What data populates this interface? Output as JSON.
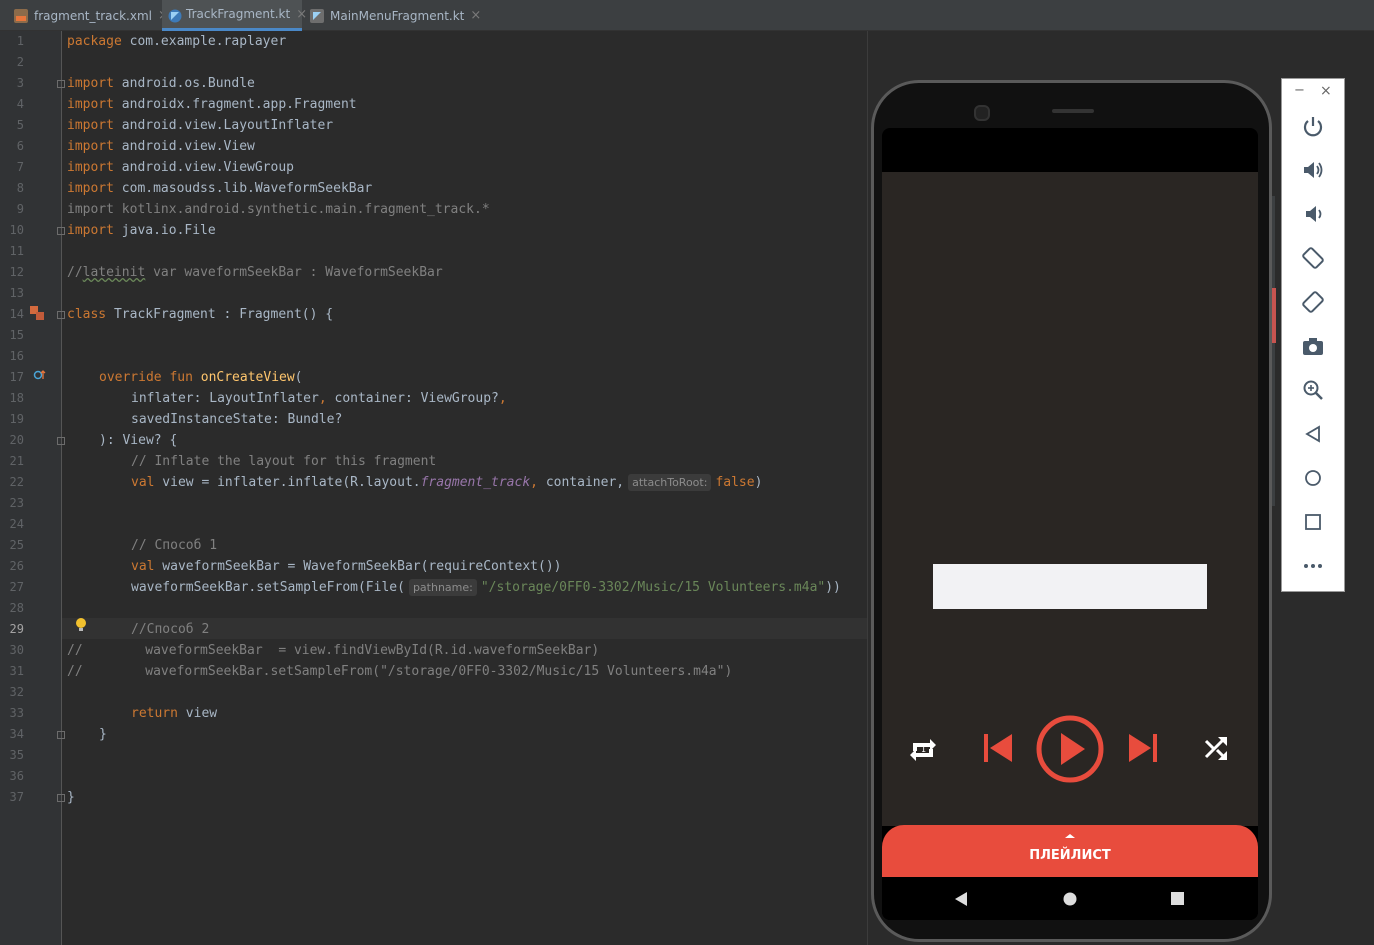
{
  "tabs": [
    {
      "label": "fragment_track.xml",
      "active": false,
      "icon": "xml-file-icon"
    },
    {
      "label": "TrackFragment.kt",
      "active": true,
      "icon": "kotlin-file-icon"
    },
    {
      "label": "MainMenuFragment.kt",
      "active": false,
      "icon": "kotlin-file-icon"
    }
  ],
  "tab_close": "×",
  "line_numbers": [
    "1",
    "2",
    "3",
    "4",
    "5",
    "6",
    "7",
    "8",
    "9",
    "10",
    "11",
    "12",
    "13",
    "14",
    "15",
    "16",
    "17",
    "18",
    "19",
    "20",
    "21",
    "22",
    "23",
    "24",
    "25",
    "26",
    "27",
    "28",
    "29",
    "30",
    "31",
    "32",
    "33",
    "34",
    "35",
    "36",
    "37"
  ],
  "current_line": "29",
  "code": {
    "l1_kw": "package",
    "l1_rest": " com.example.raplayer",
    "l3_kw": "import",
    "l3_rest": " android.os.Bundle",
    "l4_kw": "import",
    "l4_rest": " androidx.fragment.app.Fragment",
    "l5_kw": "import",
    "l5_rest": " android.view.LayoutInflater",
    "l6_kw": "import",
    "l6_rest": " android.view.View",
    "l7_kw": "import",
    "l7_rest": " android.view.ViewGroup",
    "l8_kw": "import",
    "l8_rest": " com.masoudss.lib.WaveformSeekBar",
    "l9": "import kotlinx.android.synthetic.main.fragment_track.*",
    "l10_kw": "import",
    "l10_rest": " java.io.File",
    "l12_a": "//",
    "l12_b": "lateinit",
    "l12_c": " var waveformSeekBar : WaveformSeekBar",
    "l14_kw": "class",
    "l14_rest": " TrackFragment : Fragment() {",
    "l17_kw": "override fun",
    "l17_fn": " onCreateView",
    "l17_rest": "(",
    "l18_a": "inflater: LayoutInflater",
    "l18_b": ",",
    "l18_c": " container: ViewGroup?",
    "l18_d": ",",
    "l19": "savedInstanceState: Bundle?",
    "l20": "): View? {",
    "l21": "// Inflate the layout for this fragment",
    "l22_kw": "val",
    "l22_a": " view = inflater.inflate(R.layout.",
    "l22_it": "fragment_track",
    "l22_b": ",",
    "l22_c": " container,",
    "l22_hint": "attachToRoot:",
    "l22_false": "false",
    "l22_end": ")",
    "l25": "// Способ 1",
    "l26_kw": "val",
    "l26_rest": " waveformSeekBar = WaveformSeekBar(requireContext())",
    "l27_a": "waveformSeekBar.setSampleFrom(File(",
    "l27_hint": "pathname:",
    "l27_str": "\"/storage/0FF0-3302/Music/15 Volunteers.m4a\"",
    "l27_end": "))",
    "l29": "//Способ 2",
    "l30": "//        waveformSeekBar  = view.findViewById(R.id.waveformSeekBar)",
    "l31": "//        waveformSeekBar.setSampleFrom(\"/storage/0FF0-3302/Music/15 Volunteers.m4a\")",
    "l33_kw": "return",
    "l33_rest": " view",
    "l34": "}",
    "l37": "}"
  },
  "emulator": {
    "playlist_label": "ПЛЕЙЛИСТ",
    "accent": "#e84c3d",
    "controls": [
      "repeat-one-icon",
      "skip-previous-icon",
      "play-icon",
      "skip-next-icon",
      "shuffle-icon"
    ]
  },
  "side_panel": {
    "minimize": "−",
    "close": "×",
    "buttons": [
      "power-icon",
      "volume-up-icon",
      "volume-down-icon",
      "rotate-left-icon",
      "rotate-right-icon",
      "camera-icon",
      "zoom-icon",
      "back-icon",
      "home-icon",
      "overview-icon",
      "more-icon"
    ]
  }
}
